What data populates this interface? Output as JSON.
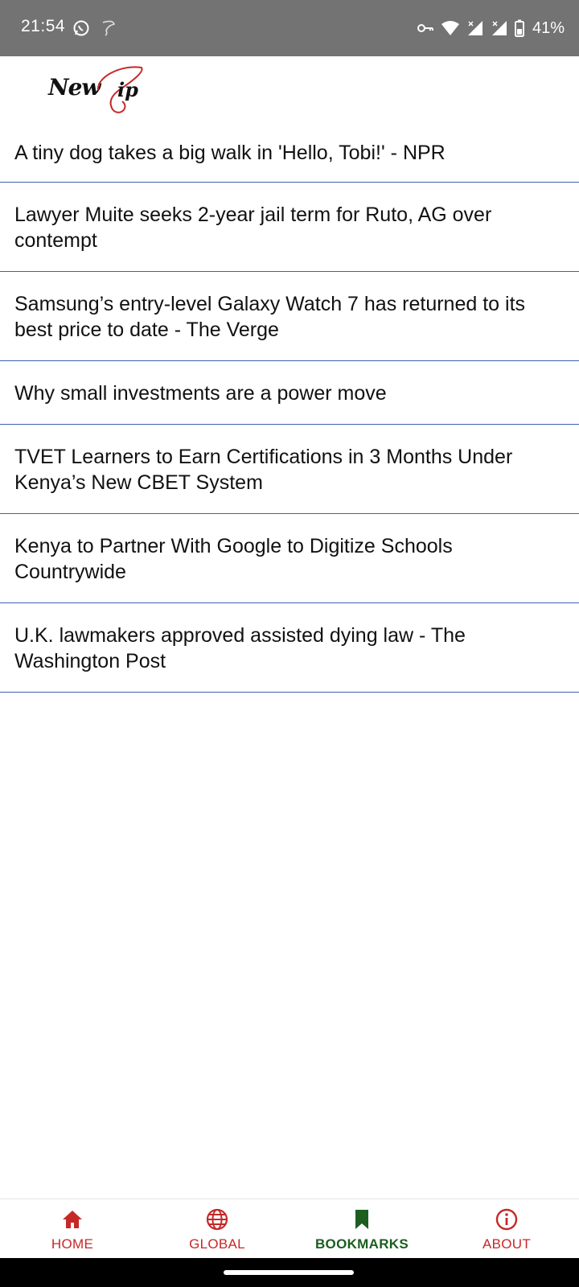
{
  "status_bar": {
    "time": "21:54",
    "battery_percent": "41%",
    "icons": [
      "whatsapp-icon",
      "notification-icon",
      "vpn-key-icon",
      "wifi-icon",
      "signal-icon",
      "signal-icon",
      "battery-icon"
    ]
  },
  "header": {
    "logo_text": "New",
    "logo_icon": "newsip-logo"
  },
  "news": [
    {
      "title": "A tiny dog takes a big walk in 'Hello, Tobi!' - NPR"
    },
    {
      "title": "Lawyer Muite seeks 2-year jail term for Ruto, AG over contempt"
    },
    {
      "title": "Samsung’s entry-level Galaxy Watch 7 has returned to its best price to date - The Verge"
    },
    {
      "title": "Why small investments are a power move"
    },
    {
      "title": "TVET Learners to Earn Certifications in 3 Months Under Kenya’s New CBET System"
    },
    {
      "title": "Kenya to Partner With Google to Digitize Schools Countrywide"
    },
    {
      "title": "U.K. lawmakers approved assisted dying law - The Washington Post"
    }
  ],
  "bottom_nav": {
    "home": {
      "label": "HOME",
      "icon": "home-icon"
    },
    "global": {
      "label": "GLOBAL",
      "icon": "globe-icon"
    },
    "bookmarks": {
      "label": "BOOKMARKS",
      "icon": "bookmark-icon",
      "active": true
    },
    "about": {
      "label": "ABOUT",
      "icon": "info-icon"
    }
  },
  "colors": {
    "accent_red": "#c62828",
    "active_green": "#1b5e20",
    "divider_blue": "#3f5fb0",
    "status_bar_gray": "#737373"
  }
}
